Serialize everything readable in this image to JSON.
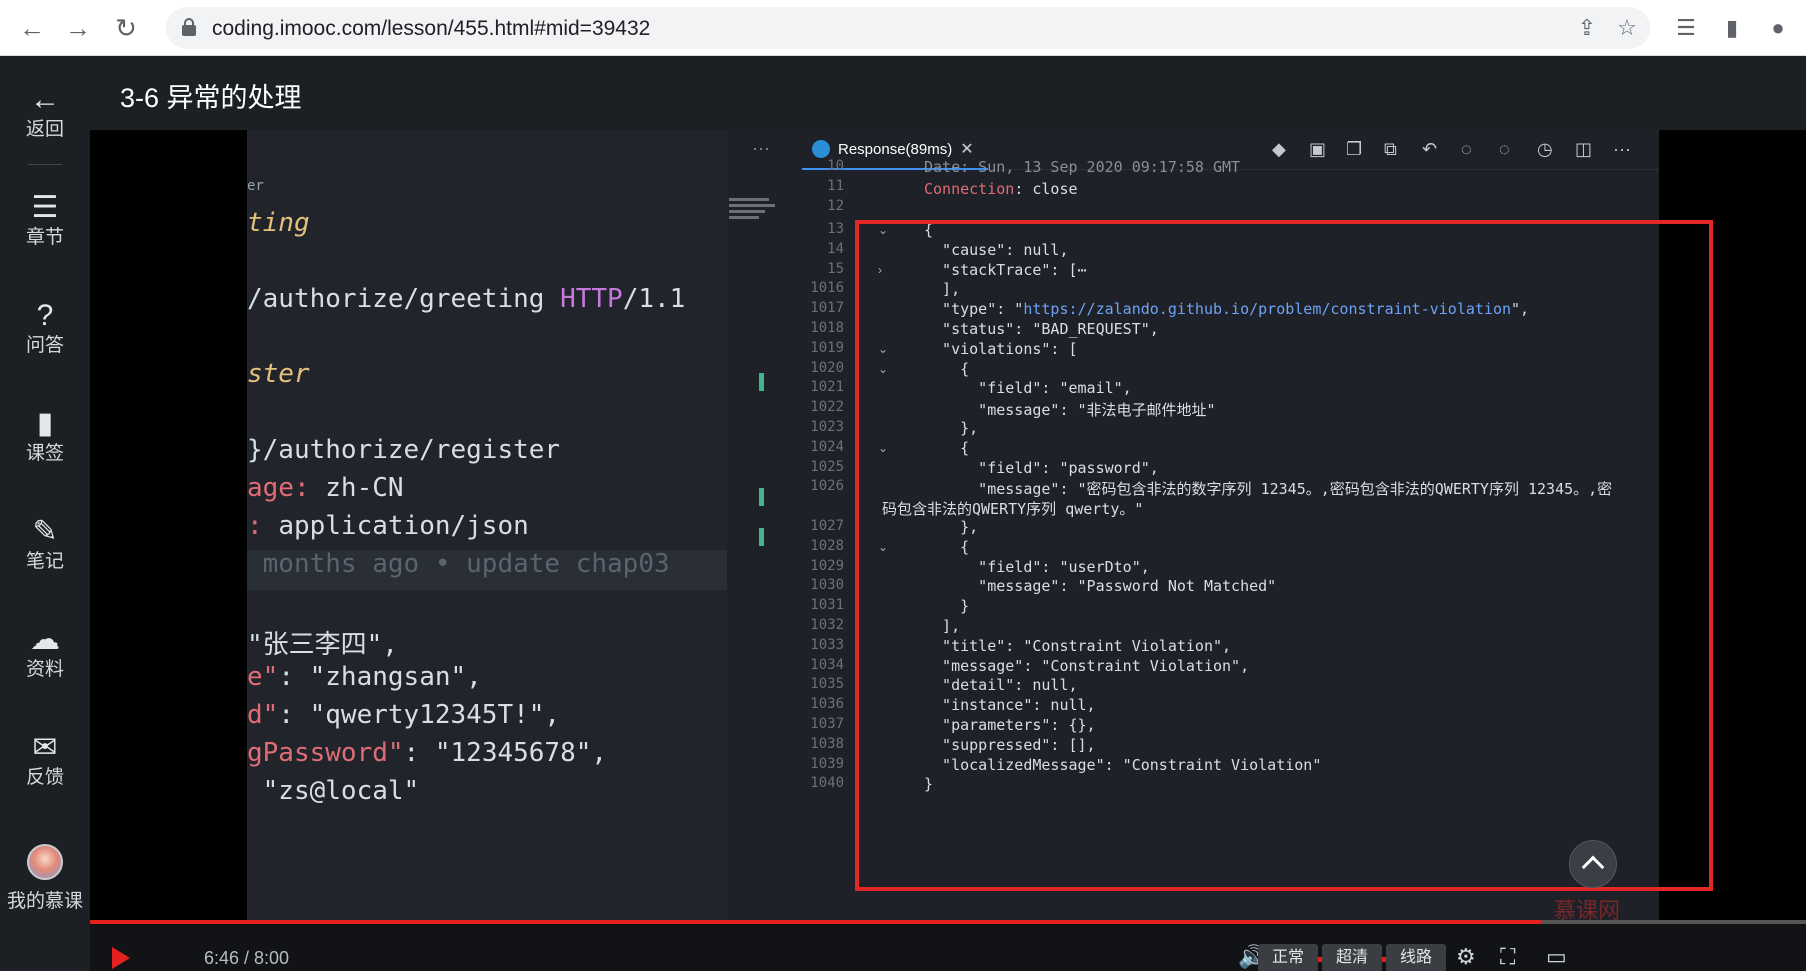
{
  "browser": {
    "url": "coding.imooc.com/lesson/455.html#mid=39432",
    "back_icon": "←",
    "forward_icon": "→",
    "reload_icon": "↻",
    "share_icon": "⇪",
    "star_icon": "☆",
    "reading_list_icon": "☰",
    "side_panel_icon": "▮",
    "profile_icon": "●"
  },
  "sidebar": {
    "items": [
      {
        "label": "返回",
        "icon": "←"
      },
      {
        "label": "章节",
        "icon": "☰"
      },
      {
        "label": "问答",
        "icon": "?"
      },
      {
        "label": "课签",
        "icon": "▮"
      },
      {
        "label": "笔记",
        "icon": "✎"
      },
      {
        "label": "资料",
        "icon": "☁"
      },
      {
        "label": "反馈",
        "icon": "✉"
      },
      {
        "label": "我的慕课",
        "icon": ""
      }
    ]
  },
  "lesson": {
    "title": "3-6 异常的处理"
  },
  "left_code": {
    "line1": "er",
    "line2": "ting",
    "line3a": "/authorize/greeting ",
    "line3b": "HTTP",
    "line3c": "/1.1",
    "line4": "ster",
    "line5": "}/authorize/register",
    "line6a": "age: ",
    "line6b": "zh-CN",
    "line7a": ": ",
    "line7b": "application/json",
    "line8": " months ago • update chap03",
    "line9": "\"张三李四\",",
    "line10a": "e\"",
    "line10b": ": \"zhangsan\",",
    "line11a": "d\"",
    "line11b": ": \"qwerty12345T!\",",
    "line12a": "gPassword\"",
    "line12b": ": \"12345678\",",
    "line13": " \"zs@local\""
  },
  "response": {
    "tab_label": "Response(89ms)",
    "tab_close": "✕",
    "more": "···",
    "header_line_partial": "Date: Sun, 13 Sep 2020 09:17:58 GMT",
    "connection_key": "Connection",
    "connection_value": ": close",
    "line_numbers": [
      "10",
      "11",
      "12",
      "13",
      "14",
      "15",
      "1016",
      "1017",
      "1018",
      "1019",
      "1020",
      "1021",
      "1022",
      "1023",
      "1024",
      "1025",
      "1026",
      "1027",
      "1028",
      "1029",
      "1030",
      "1031",
      "1032",
      "1033",
      "1034",
      "1035",
      "1036",
      "1037",
      "1038",
      "1039",
      "1040"
    ],
    "lines": [
      "{",
      "  \"cause\": null,",
      "  \"stackTrace\": [⋯",
      "  ],",
      "  \"type\": \"",
      "  \"status\": \"BAD_REQUEST\",",
      "  \"violations\": [",
      "    {",
      "      \"field\": \"email\",",
      "      \"message\": \"非法电子邮件地址\"",
      "    },",
      "    {",
      "      \"field\": \"password\",",
      "      \"message\": \"密码包含非法的数字序列 12345。,密码包含非法的QWERTY序列 12345。,密",
      "码包含非法的QWERTY序列 qwerty。\"",
      "    },",
      "    {",
      "      \"field\": \"userDto\",",
      "      \"message\": \"Password Not Matched\"",
      "    }",
      "  ],",
      "  \"title\": \"Constraint Violation\",",
      "  \"message\": \"Constraint Violation\",",
      "  \"detail\": null,",
      "  \"instance\": null,",
      "  \"parameters\": {},",
      "  \"suppressed\": [],",
      "  \"localizedMessage\": \"Constraint Violation\"",
      "}"
    ],
    "type_link": "https://zalando.github.io/problem/constraint-violation",
    "type_tail": "\","
  },
  "player": {
    "time": "6:46 / 8:00",
    "progress": 0.8458,
    "volume": 0.85,
    "btn_normal": "正常",
    "btn_quality": "超清",
    "btn_line": "线路",
    "watermark": "慕课网",
    "volume_icon": "🔊",
    "settings_icon": "⚙",
    "fullscreen_icon": "⛶",
    "theater_icon": "▭"
  },
  "colors": {
    "accent_red": "#e3221f",
    "highlight_box": "#e32626"
  }
}
